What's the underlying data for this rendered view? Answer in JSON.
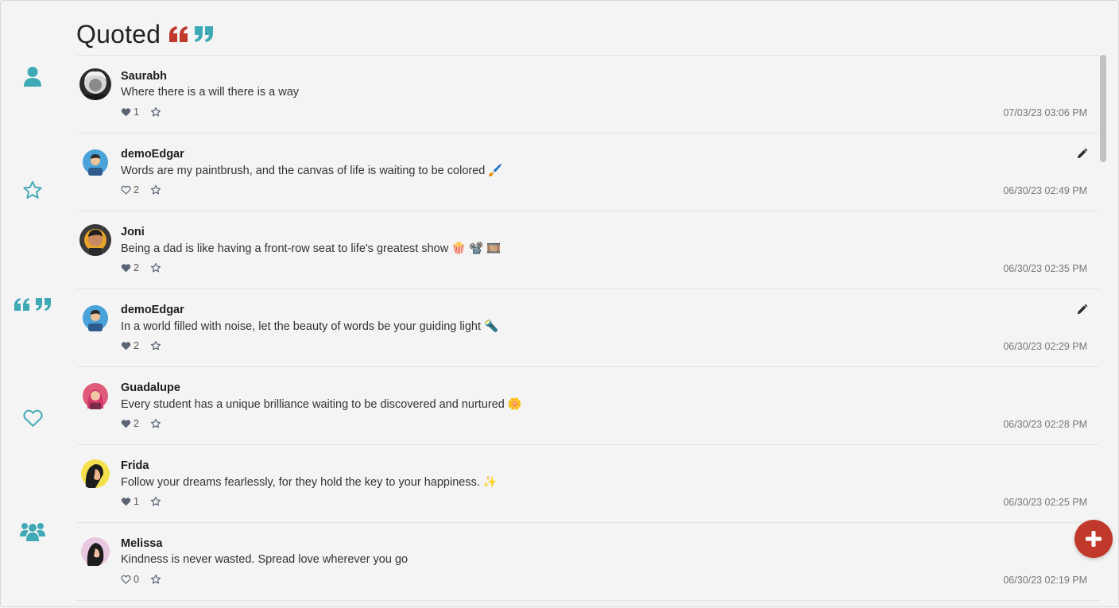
{
  "app": {
    "title": "Quoted",
    "colors": {
      "accent": "#3fa9b5",
      "brand_red": "#c0392b",
      "background": "#f4f4f4"
    }
  },
  "sidebar": {
    "items": [
      {
        "name": "profile",
        "icon": "user-icon"
      },
      {
        "name": "favorites",
        "icon": "star-icon"
      },
      {
        "name": "quotes",
        "icon": "quote-icon"
      },
      {
        "name": "liked",
        "icon": "heart-icon"
      },
      {
        "name": "community",
        "icon": "users-icon"
      }
    ]
  },
  "posts": [
    {
      "author": "Saurabh",
      "text": "Where there is a will there is a way",
      "likes": "1",
      "liked": true,
      "time": "07/03/23 03:06 PM",
      "editable": false
    },
    {
      "author": "demoEdgar",
      "text": "Words are my paintbrush, and the canvas of life is waiting to be colored 🖌️",
      "likes": "2",
      "liked": false,
      "time": "06/30/23 02:49 PM",
      "editable": true
    },
    {
      "author": "Joni",
      "text": "Being a dad is like having a front-row seat to life's greatest show 🍿 📽️ 🎞️",
      "likes": "2",
      "liked": true,
      "time": "06/30/23 02:35 PM",
      "editable": false
    },
    {
      "author": "demoEdgar",
      "text": "In a world filled with noise, let the beauty of words be your guiding light 🔦",
      "likes": "2",
      "liked": true,
      "time": "06/30/23 02:29 PM",
      "editable": true
    },
    {
      "author": "Guadalupe",
      "text": "Every student has a unique brilliance waiting to be discovered and nurtured 🌼",
      "likes": "2",
      "liked": true,
      "time": "06/30/23 02:28 PM",
      "editable": false
    },
    {
      "author": "Frida",
      "text": "Follow your dreams fearlessly, for they hold the key to your happiness. ✨",
      "likes": "1",
      "liked": true,
      "time": "06/30/23 02:25 PM",
      "editable": false
    },
    {
      "author": "Melissa",
      "text": "Kindness is never wasted. Spread love wherever you go",
      "likes": "0",
      "liked": false,
      "time": "06/30/23 02:19 PM",
      "editable": false
    }
  ],
  "fab": {
    "icon": "plus-icon"
  }
}
